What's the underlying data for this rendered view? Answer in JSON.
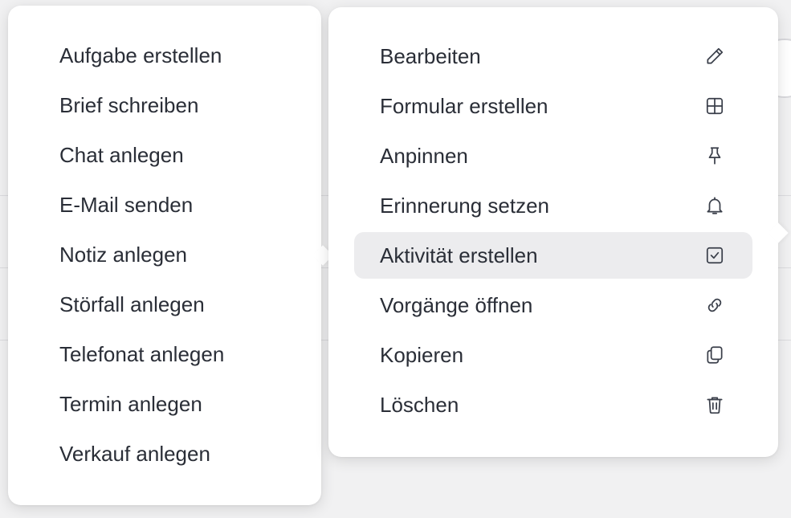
{
  "left_menu": {
    "items": [
      {
        "label": "Aufgabe erstellen"
      },
      {
        "label": "Brief schreiben"
      },
      {
        "label": "Chat anlegen"
      },
      {
        "label": "E-Mail senden"
      },
      {
        "label": "Notiz anlegen"
      },
      {
        "label": "Störfall anlegen"
      },
      {
        "label": "Telefonat anlegen"
      },
      {
        "label": "Termin anlegen"
      },
      {
        "label": "Verkauf anlegen"
      }
    ]
  },
  "right_menu": {
    "items": [
      {
        "label": "Bearbeiten",
        "icon": "pencil-icon"
      },
      {
        "label": "Formular erstellen",
        "icon": "grid-icon"
      },
      {
        "label": "Anpinnen",
        "icon": "pin-icon"
      },
      {
        "label": "Erinnerung setzen",
        "icon": "bell-icon"
      },
      {
        "label": "Aktivität erstellen",
        "icon": "checkbox-icon",
        "active": true
      },
      {
        "label": "Vorgänge öffnen",
        "icon": "link-icon"
      },
      {
        "label": "Kopieren",
        "icon": "copy-icon"
      },
      {
        "label": "Löschen",
        "icon": "trash-icon"
      }
    ]
  },
  "colors": {
    "menu_bg": "#ffffff",
    "active_bg": "#ececee",
    "text": "#2a2e37",
    "backdrop": "#f1f1f2"
  }
}
